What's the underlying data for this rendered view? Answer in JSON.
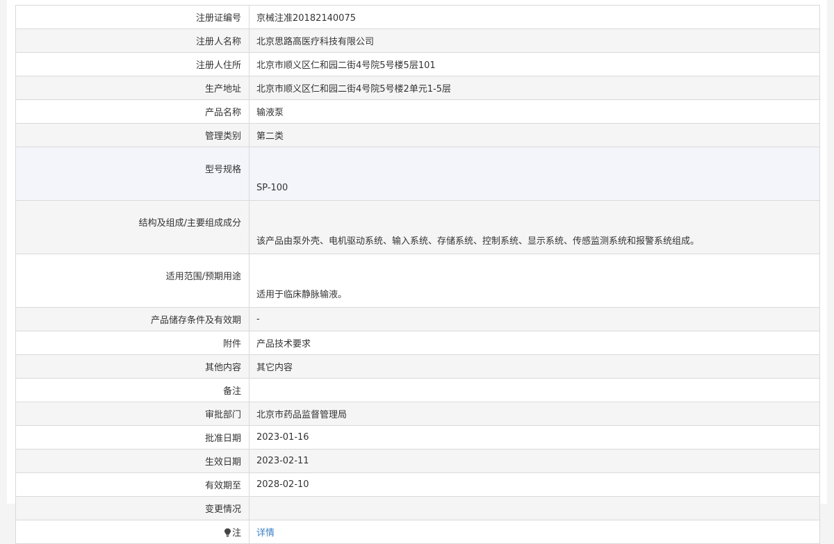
{
  "rows": [
    {
      "label": "注册证编号",
      "value": "京械注准20182140075"
    },
    {
      "label": "注册人名称",
      "value": "北京思路高医疗科技有限公司"
    },
    {
      "label": "注册人住所",
      "value": "北京市顺义区仁和园二街4号院5号楼5层101"
    },
    {
      "label": "生产地址",
      "value": "北京市顺义区仁和园二街4号院5号楼2单元1-5层"
    },
    {
      "label": "产品名称",
      "value": "输液泵"
    },
    {
      "label": "管理类别",
      "value": "第二类"
    },
    {
      "label": "型号规格",
      "value": "SP-100"
    },
    {
      "label": "结构及组成/主要组成成分",
      "value": "该产品由泵外壳、电机驱动系统、输入系统、存储系统、控制系统、显示系统、传感监测系统和报警系统组成。"
    },
    {
      "label": "适用范围/预期用途",
      "value": "适用于临床静脉输液。"
    },
    {
      "label": "产品储存条件及有效期",
      "value": "-"
    },
    {
      "label": "附件",
      "value": "产品技术要求"
    },
    {
      "label": "其他内容",
      "value": "其它内容"
    },
    {
      "label": "备注",
      "value": ""
    },
    {
      "label": "审批部门",
      "value": "北京市药品监督管理局"
    },
    {
      "label": "批准日期",
      "value": "2023-01-16"
    },
    {
      "label": "生效日期",
      "value": "2023-02-11"
    },
    {
      "label": "有效期至",
      "value": "2028-02-10"
    },
    {
      "label": "变更情况",
      "value": ""
    },
    {
      "label": "注",
      "value": "详情"
    }
  ],
  "icons": {
    "note": "lightbulb-icon"
  },
  "colors": {
    "link": "#3b7fc4",
    "border": "#d9d9d9",
    "stripe": "#f5f5f5"
  }
}
